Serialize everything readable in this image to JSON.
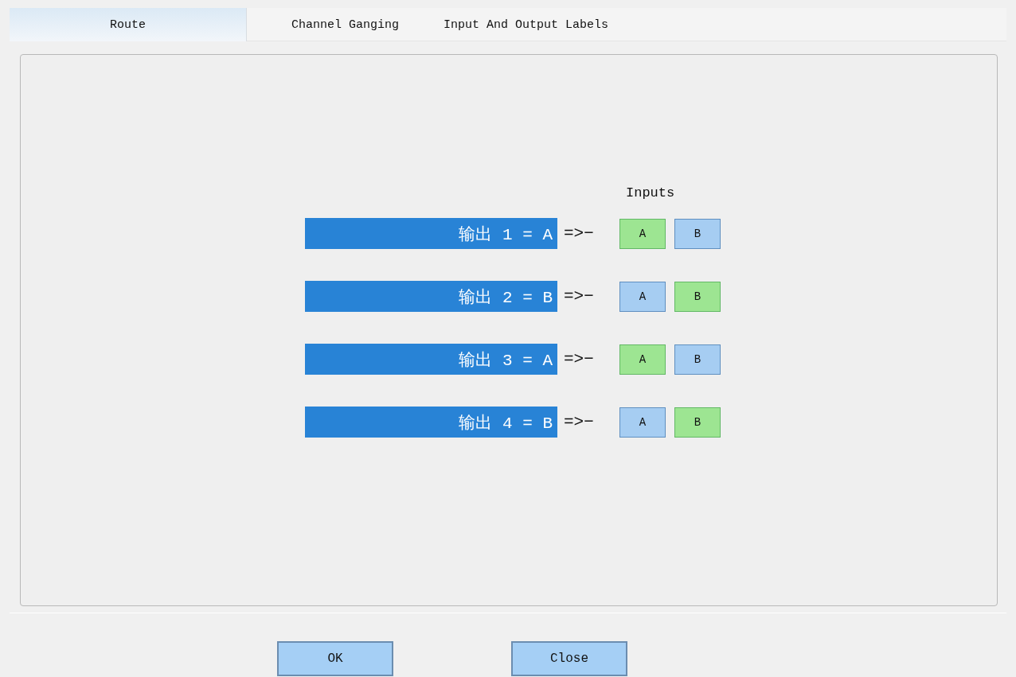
{
  "tabs": [
    {
      "label": "Route",
      "selected": true
    },
    {
      "label": "Channel Ganging",
      "selected": false
    },
    {
      "label": "Input And Output Labels",
      "selected": false
    }
  ],
  "route": {
    "inputs_label": "Inputs",
    "rows": [
      {
        "label": "输出 1 = A",
        "arrow": "=>−",
        "inputs": [
          {
            "label": "A",
            "selected": true
          },
          {
            "label": "B",
            "selected": false
          }
        ]
      },
      {
        "label": "输出 2 = B",
        "arrow": "=>−",
        "inputs": [
          {
            "label": "A",
            "selected": false
          },
          {
            "label": "B",
            "selected": true
          }
        ]
      },
      {
        "label": "输出 3 = A",
        "arrow": "=>−",
        "inputs": [
          {
            "label": "A",
            "selected": true
          },
          {
            "label": "B",
            "selected": false
          }
        ]
      },
      {
        "label": "输出 4 = B",
        "arrow": "=>−",
        "inputs": [
          {
            "label": "A",
            "selected": false
          },
          {
            "label": "B",
            "selected": true
          }
        ]
      }
    ]
  },
  "buttons": [
    "OK",
    "Close"
  ]
}
